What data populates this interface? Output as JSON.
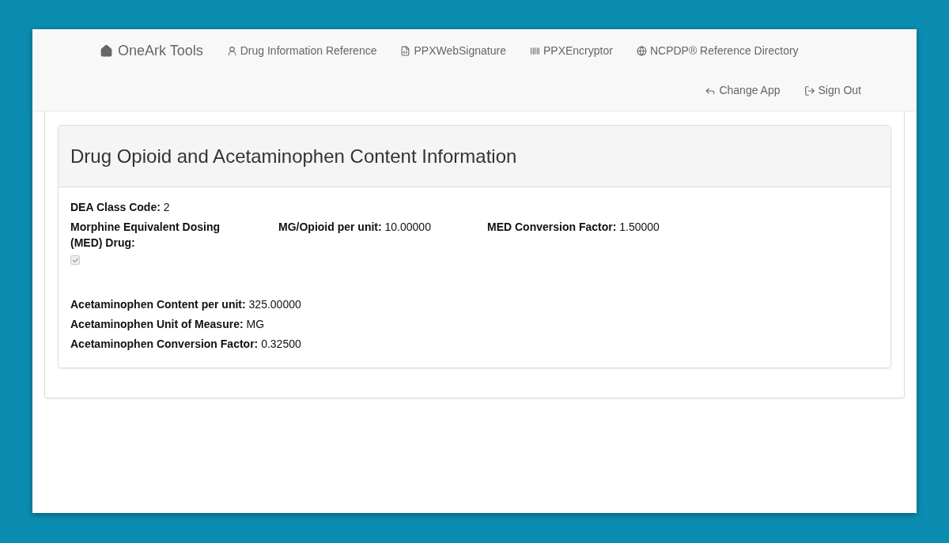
{
  "navbar": {
    "brand": "OneArk Tools",
    "items": [
      {
        "label": "Drug Information Reference"
      },
      {
        "label": "PPXWebSignature"
      },
      {
        "label": "PPXEncryptor"
      },
      {
        "label": "NCPDP® Reference Directory"
      }
    ],
    "right_items": [
      {
        "label": "Change App"
      },
      {
        "label": "Sign Out"
      }
    ]
  },
  "panel": {
    "title": "Drug Opioid and Acetaminophen Content Information",
    "rows": [
      [
        {
          "kind": "text",
          "label": "DEA Class Code:",
          "value": "2"
        }
      ],
      [
        {
          "kind": "checkbox",
          "label": "Morphine Equivalent Dosing (MED) Drug:",
          "checked": true,
          "disabled": true
        },
        {
          "kind": "text",
          "label": "MG/Opioid per unit:",
          "value": "10.00000"
        },
        {
          "kind": "text",
          "label": "MED Conversion Factor:",
          "value": "1.50000"
        }
      ],
      [
        {
          "kind": "text",
          "label": "Acetaminophen Content per unit:",
          "value": "325.00000"
        }
      ],
      [
        {
          "kind": "text",
          "label": "Acetaminophen Unit of Measure:",
          "value": "MG"
        }
      ],
      [
        {
          "kind": "text",
          "label": "Acetaminophen Conversion Factor:",
          "value": "0.32500"
        }
      ]
    ]
  }
}
